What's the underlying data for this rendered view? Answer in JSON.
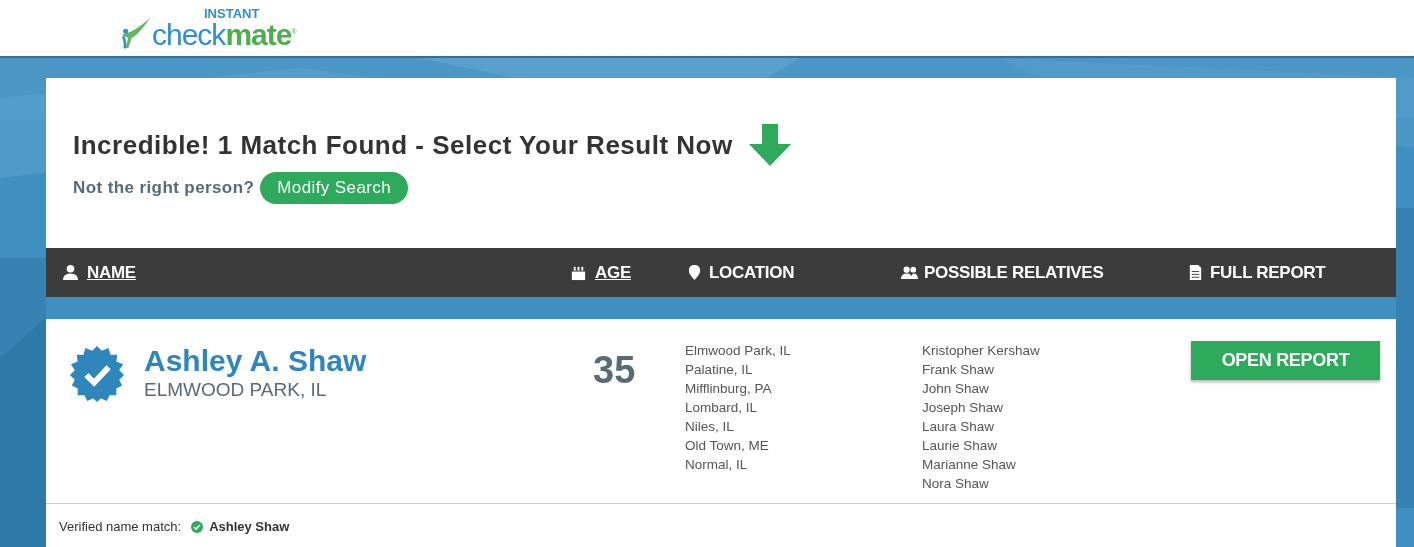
{
  "logo": {
    "top": "INSTANT",
    "first": "check",
    "second": "mate",
    "mark": "®"
  },
  "headline": "Incredible! 1 Match Found - Select Your Result Now",
  "subline": {
    "text": "Not the right person?",
    "button": "Modify Search"
  },
  "columns": [
    {
      "label": "NAME",
      "kind": "person",
      "sortable": true
    },
    {
      "label": "AGE",
      "kind": "cake",
      "sortable": true
    },
    {
      "label": "LOCATION",
      "kind": "pin",
      "sortable": false
    },
    {
      "label": "POSSIBLE RELATIVES",
      "kind": "people",
      "sortable": false
    },
    {
      "label": "FULL REPORT",
      "kind": "document",
      "sortable": false
    }
  ],
  "results": [
    {
      "verified": true,
      "name": "Ashley A. Shaw",
      "city": "ELMWOOD PARK, IL",
      "age": "35",
      "locations": [
        "Elmwood Park, IL",
        "Palatine, IL",
        "Mifflinburg, PA",
        "Lombard, IL",
        "Niles, IL",
        "Old Town, ME",
        "Normal, IL"
      ],
      "relatives": [
        "Kristopher Kershaw",
        "Frank Shaw",
        "John Shaw",
        "Joseph Shaw",
        "Laura Shaw",
        "Laurie Shaw",
        "Marianne Shaw",
        "Nora Shaw"
      ],
      "button": "OPEN REPORT",
      "match_label": "Verified name match:",
      "match_name": "Ashley Shaw"
    }
  ]
}
